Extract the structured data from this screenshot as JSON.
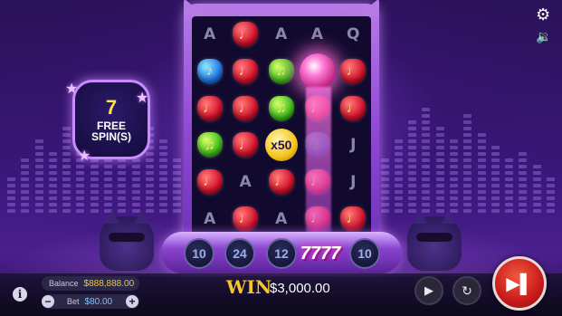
{
  "free_spins": {
    "count": "7",
    "label_line1": "FREE",
    "label_line2": "SPIN(S)"
  },
  "reels": {
    "rows": [
      [
        {
          "type": "letter",
          "text": "A"
        },
        {
          "type": "gem",
          "color": "red",
          "text": "♩"
        },
        {
          "type": "letter",
          "text": "A"
        },
        {
          "type": "letter",
          "text": "A"
        },
        {
          "type": "letter",
          "text": "Q"
        }
      ],
      [
        {
          "type": "gem",
          "color": "blue",
          "text": "♪"
        },
        {
          "type": "gem",
          "color": "red",
          "text": "♩"
        },
        {
          "type": "gem",
          "color": "green",
          "text": "♫"
        },
        {
          "type": "disco",
          "text": ""
        },
        {
          "type": "gem",
          "color": "red",
          "text": "♩"
        }
      ],
      [
        {
          "type": "gem",
          "color": "red",
          "text": "♩"
        },
        {
          "type": "gem",
          "color": "red",
          "text": "♩"
        },
        {
          "type": "gem",
          "color": "green",
          "text": "♫"
        },
        {
          "type": "gem",
          "color": "red",
          "text": "♩"
        },
        {
          "type": "gem",
          "color": "red",
          "text": "♩"
        }
      ],
      [
        {
          "type": "gem",
          "color": "green",
          "text": "♫"
        },
        {
          "type": "gem",
          "color": "red",
          "text": "♩"
        },
        {
          "type": "multiplier",
          "text": "x50"
        },
        {
          "type": "gem-dim",
          "color": "blue",
          "text": "♪"
        },
        {
          "type": "letter",
          "text": "J"
        }
      ],
      [
        {
          "type": "gem",
          "color": "red",
          "text": "♩"
        },
        {
          "type": "letter",
          "text": "A"
        },
        {
          "type": "gem",
          "color": "red",
          "text": "♩"
        },
        {
          "type": "gem",
          "color": "red",
          "text": "♩"
        },
        {
          "type": "letter",
          "text": "J"
        }
      ],
      [
        {
          "type": "letter",
          "text": "A"
        },
        {
          "type": "gem",
          "color": "red",
          "text": "♩"
        },
        {
          "type": "letter",
          "text": "A"
        },
        {
          "type": "gem",
          "color": "red",
          "text": "♩"
        },
        {
          "type": "gem",
          "color": "red",
          "text": "♩"
        }
      ]
    ]
  },
  "counters": [
    "10",
    "24",
    "12",
    "7777",
    "10"
  ],
  "balance": {
    "label": "Balance",
    "value": "$888,888.00"
  },
  "bet": {
    "label": "Bet",
    "value": "$80.00",
    "minus": "−",
    "plus": "+"
  },
  "win": {
    "label": "WIN",
    "amount": "$3,000.00"
  },
  "icons": {
    "settings": "⚙",
    "sound": "🔉",
    "info": "i",
    "play": "▶",
    "auto": "↻",
    "spin": "▶▌"
  },
  "colors": {
    "accent": "#f4c52e",
    "spin": "#c81b1b",
    "frame": "#8d48d2"
  }
}
